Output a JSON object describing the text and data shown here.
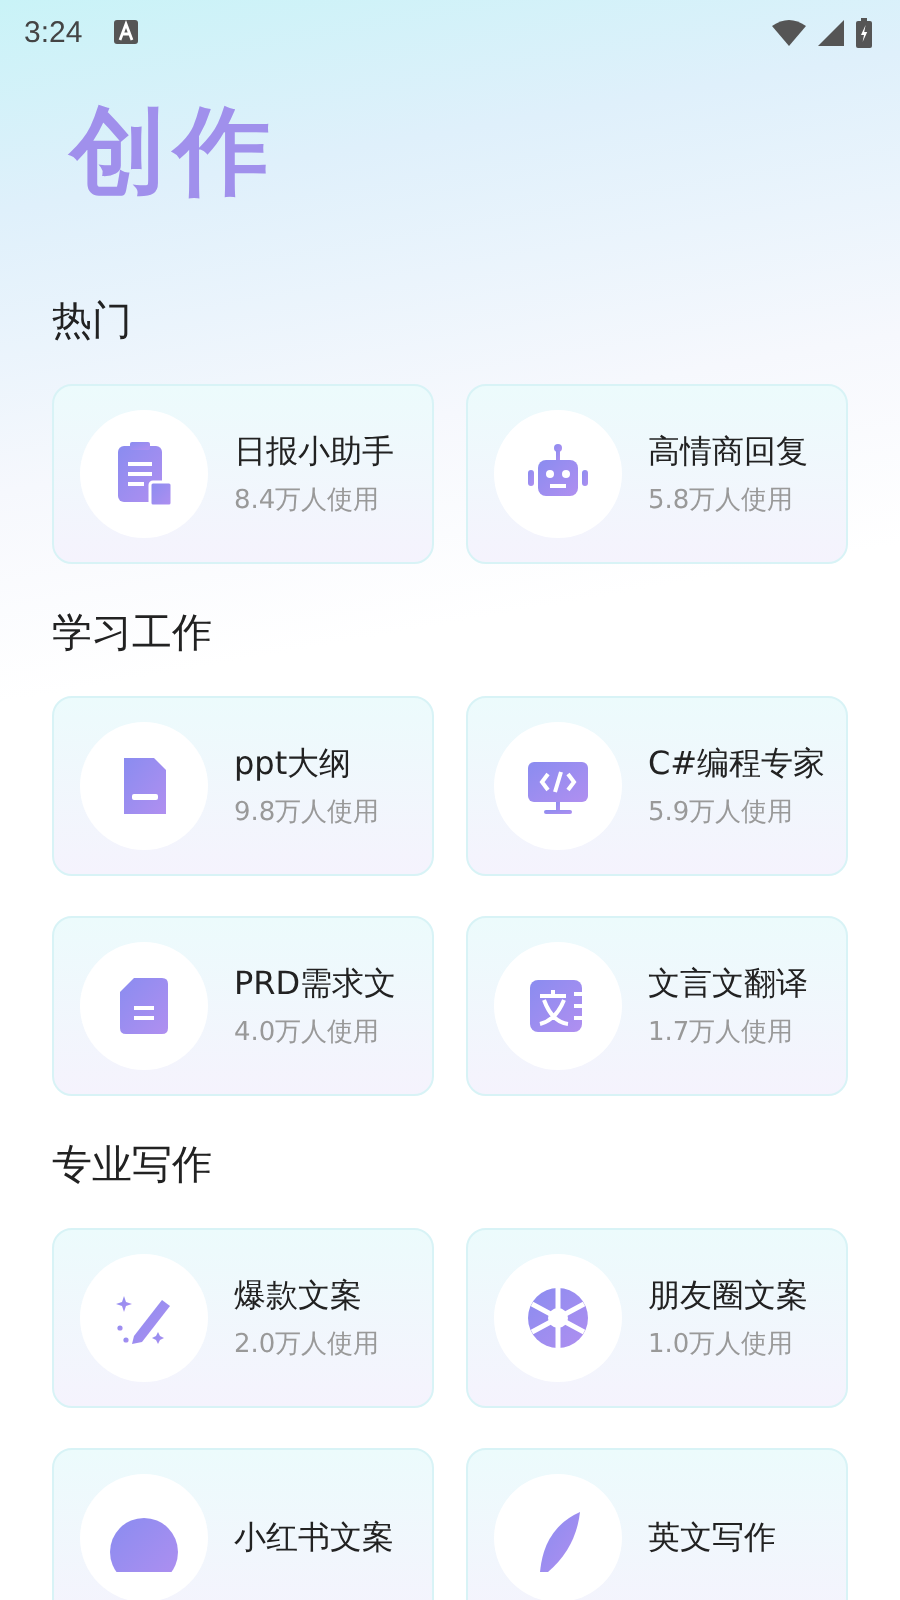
{
  "status_bar": {
    "time": "3:24"
  },
  "title": "创作",
  "sections": [
    {
      "heading": "热门",
      "cards": [
        {
          "title": "日报小助手",
          "users": "8.4万人使用"
        },
        {
          "title": "高情商回复",
          "users": "5.8万人使用"
        }
      ]
    },
    {
      "heading": "学习工作",
      "cards": [
        {
          "title": "ppt大纲",
          "users": "9.8万人使用"
        },
        {
          "title": "C#编程专家",
          "users": "5.9万人使用"
        },
        {
          "title": "PRD需求文",
          "users": "4.0万人使用"
        },
        {
          "title": "文言文翻译",
          "users": "1.7万人使用"
        }
      ]
    },
    {
      "heading": "专业写作",
      "cards": [
        {
          "title": "爆款文案",
          "users": "2.0万人使用"
        },
        {
          "title": "朋友圈文案",
          "users": "1.0万人使用"
        },
        {
          "title": "小红书文案"
        },
        {
          "title": "英文写作"
        }
      ]
    }
  ]
}
